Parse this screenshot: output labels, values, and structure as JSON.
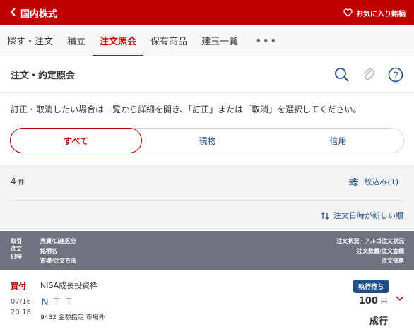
{
  "header": {
    "back_label": "国内株式",
    "favorite_label": "お気に入り銘柄"
  },
  "tabs": [
    {
      "label": "探す・注文"
    },
    {
      "label": "積立"
    },
    {
      "label": "注文照会"
    },
    {
      "label": "保有商品"
    },
    {
      "label": "建玉一覧"
    },
    {
      "label": "•••"
    }
  ],
  "section": {
    "title": "注文・約定照会"
  },
  "notice": "訂正・取消したい場合は一覧から詳細を開き、「訂正」または「取消」を選択してください。",
  "segments": [
    {
      "label": "すべて"
    },
    {
      "label": "現物"
    },
    {
      "label": "信用"
    }
  ],
  "list": {
    "count": "4",
    "count_unit": "件",
    "filter_label": "絞込み(1)",
    "sort_label": "注文日時が新しい順"
  },
  "table_header": {
    "col1": [
      "取引",
      "注文",
      "日時"
    ],
    "col2": [
      "売買/口座区分",
      "銘柄名",
      "市場/注文方法"
    ],
    "col3": [
      "注文状況・アルゴ注文状況",
      "注文数量/注文金額",
      "注文価格"
    ]
  },
  "orders": [
    {
      "side": "買付",
      "account": "NISA成長投資枠",
      "date": "07/16",
      "time": "20:18",
      "name": "ＮＴＴ",
      "code_line": "9432 金額指定 市場外",
      "status": "執行待ち",
      "price": "100",
      "price_unit": "円",
      "execution": "成行"
    }
  ],
  "colors": {
    "brand_red": "#c00000",
    "link_blue": "#1a4f8b",
    "header_gray": "#6f7380"
  },
  "icons": [
    "chevron-left-icon",
    "heart-icon",
    "search-icon",
    "paperclip-icon",
    "help-icon",
    "filter-icon",
    "sort-icon",
    "chevron-down-icon"
  ]
}
